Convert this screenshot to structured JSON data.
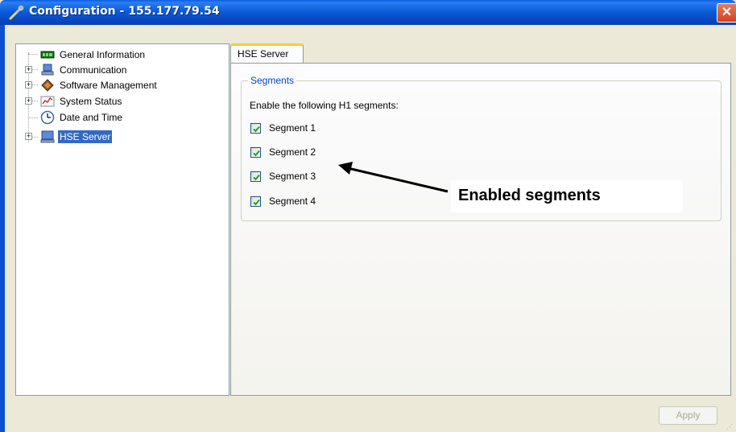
{
  "window": {
    "title": "Configuration - 155.177.79.54",
    "close_glyph": "✕"
  },
  "tree": {
    "items": [
      {
        "label": "General Information",
        "icon": "general-info-icon",
        "expandable": false,
        "selected": false
      },
      {
        "label": "Communication",
        "icon": "network-icon",
        "expandable": true,
        "selected": false
      },
      {
        "label": "Software Management",
        "icon": "software-icon",
        "expandable": true,
        "selected": false
      },
      {
        "label": "System Status",
        "icon": "chart-icon",
        "expandable": true,
        "selected": false
      },
      {
        "label": "Date and Time",
        "icon": "clock-icon",
        "expandable": false,
        "selected": false
      },
      {
        "label": "HSE Server",
        "icon": "computer-icon",
        "expandable": true,
        "selected": true
      }
    ]
  },
  "tab": {
    "label": "HSE Server"
  },
  "segments": {
    "group_label": "Segments",
    "description": "Enable the following H1 segments:",
    "items": [
      {
        "label": "Segment 1",
        "checked": true
      },
      {
        "label": "Segment 2",
        "checked": true
      },
      {
        "label": "Segment 3",
        "checked": true
      },
      {
        "label": "Segment 4",
        "checked": true
      }
    ]
  },
  "annotation": {
    "text": "Enabled segments"
  },
  "footer": {
    "apply_label": "Apply"
  },
  "colors": {
    "title_bar": "#0a5fe0",
    "selection": "#316ac5",
    "group_label": "#0046d5",
    "checkmark": "#21a121",
    "close_button": "#d2421c"
  }
}
